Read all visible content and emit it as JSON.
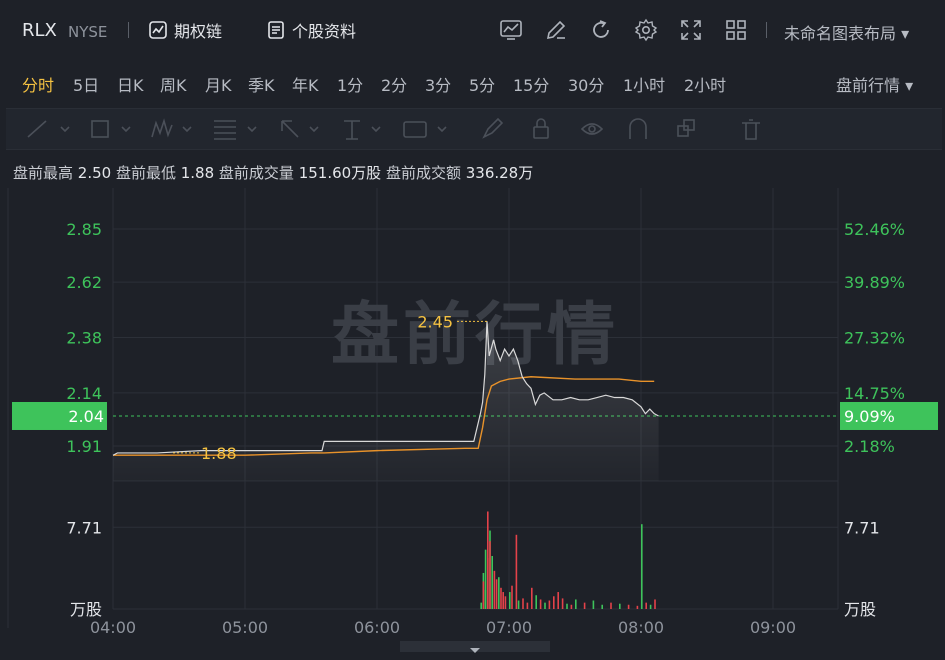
{
  "header": {
    "symbol": "RLX",
    "exchange": "NYSE",
    "option_chain_label": "期权链",
    "profile_label": "个股资料",
    "layout_label": "未命名图表布局"
  },
  "periods": [
    "分时",
    "5日",
    "日K",
    "周K",
    "月K",
    "季K",
    "年K",
    "1分",
    "2分",
    "3分",
    "5分",
    "15分",
    "30分",
    "1小时",
    "2小时"
  ],
  "active_period": "分时",
  "premarket_menu_label": "盘前行情",
  "stats": [
    {
      "label": "盘前最高",
      "value": "2.50"
    },
    {
      "label": "盘前最低",
      "value": "1.88"
    },
    {
      "label": "盘前成交量",
      "value": "151.60万股"
    },
    {
      "label": "盘前成交额",
      "value": "336.28万"
    }
  ],
  "colors": {
    "up": "#3ec35b",
    "down": "#e4424a",
    "price_line": "#d9d9d9",
    "avg_line": "#e8922a",
    "highlight": "#f5c242",
    "bg": "#1e2128"
  },
  "chart_data": {
    "type": "line",
    "watermark": "盘前行情",
    "x_ticks": [
      "04:00",
      "05:00",
      "06:00",
      "07:00",
      "08:00",
      "09:00"
    ],
    "x_range": [
      "04:00",
      "09:30"
    ],
    "y_ticks_left": [
      "2.85",
      "2.62",
      "2.38",
      "2.14",
      "1.91"
    ],
    "y_ticks_right": [
      "52.46%",
      "39.89%",
      "27.32%",
      "14.75%",
      "2.18%"
    ],
    "y_range": [
      1.7,
      2.95
    ],
    "prev_close": 2.04,
    "prev_close_label": "2.04",
    "prev_close_pct": "9.09%",
    "high_marker": {
      "time": "06:50",
      "value": 2.45,
      "label": "2.45"
    },
    "low_marker": {
      "time": "04:40",
      "value": 1.88,
      "label": "1.88"
    },
    "price": [
      [
        "04:00",
        1.87
      ],
      [
        "04:02",
        1.88
      ],
      [
        "04:10",
        1.88
      ],
      [
        "04:20",
        1.88
      ],
      [
        "04:40",
        1.89
      ],
      [
        "05:00",
        1.89
      ],
      [
        "05:20",
        1.89
      ],
      [
        "05:30",
        1.89
      ],
      [
        "05:35",
        1.89
      ],
      [
        "05:36",
        1.93
      ],
      [
        "05:50",
        1.93
      ],
      [
        "06:00",
        1.93
      ],
      [
        "06:20",
        1.93
      ],
      [
        "06:40",
        1.93
      ],
      [
        "06:44",
        1.93
      ],
      [
        "06:47",
        2.05
      ],
      [
        "06:48",
        2.1
      ],
      [
        "06:49",
        2.22
      ],
      [
        "06:50",
        2.45
      ],
      [
        "06:51",
        2.3
      ],
      [
        "06:53",
        2.37
      ],
      [
        "06:54",
        2.33
      ],
      [
        "06:56",
        2.28
      ],
      [
        "06:58",
        2.33
      ],
      [
        "07:00",
        2.3
      ],
      [
        "07:02",
        2.33
      ],
      [
        "07:04",
        2.28
      ],
      [
        "07:06",
        2.21
      ],
      [
        "07:08",
        2.18
      ],
      [
        "07:10",
        2.16
      ],
      [
        "07:12",
        2.09
      ],
      [
        "07:14",
        2.13
      ],
      [
        "07:16",
        2.14
      ],
      [
        "07:20",
        2.11
      ],
      [
        "07:24",
        2.11
      ],
      [
        "07:28",
        2.12
      ],
      [
        "07:32",
        2.11
      ],
      [
        "07:36",
        2.11
      ],
      [
        "07:40",
        2.12
      ],
      [
        "07:44",
        2.13
      ],
      [
        "07:48",
        2.12
      ],
      [
        "07:52",
        2.12
      ],
      [
        "07:56",
        2.11
      ],
      [
        "08:00",
        2.08
      ],
      [
        "08:02",
        2.05
      ],
      [
        "08:04",
        2.07
      ],
      [
        "08:06",
        2.05
      ],
      [
        "08:08",
        2.04
      ]
    ],
    "avg": [
      [
        "04:00",
        1.87
      ],
      [
        "04:30",
        1.87
      ],
      [
        "05:00",
        1.87
      ],
      [
        "05:30",
        1.88
      ],
      [
        "05:36",
        1.88
      ],
      [
        "06:00",
        1.89
      ],
      [
        "06:40",
        1.9
      ],
      [
        "06:46",
        1.9
      ],
      [
        "06:48",
        1.99
      ],
      [
        "06:50",
        2.11
      ],
      [
        "06:52",
        2.17
      ],
      [
        "06:56",
        2.19
      ],
      [
        "07:00",
        2.2
      ],
      [
        "07:10",
        2.21
      ],
      [
        "07:30",
        2.2
      ],
      [
        "07:50",
        2.2
      ],
      [
        "08:00",
        2.19
      ],
      [
        "08:06",
        2.19
      ]
    ],
    "volume_label": "7.71",
    "volume_unit": "万股",
    "volume_max": 10,
    "volume": [
      [
        "06:47",
        0.6,
        "up"
      ],
      [
        "06:47",
        3.4,
        "up"
      ],
      [
        "06:48",
        2.6,
        "down"
      ],
      [
        "06:48",
        1.8,
        "up"
      ],
      [
        "06:49",
        5.6,
        "up"
      ],
      [
        "06:49",
        4.8,
        "down"
      ],
      [
        "06:50",
        9.2,
        "down"
      ],
      [
        "06:50",
        7.4,
        "up"
      ],
      [
        "06:51",
        6.4,
        "down"
      ],
      [
        "06:52",
        5.0,
        "up"
      ],
      [
        "06:53",
        3.6,
        "down"
      ],
      [
        "06:54",
        2.8,
        "down"
      ],
      [
        "06:55",
        3.0,
        "up"
      ],
      [
        "06:56",
        2.0,
        "down"
      ],
      [
        "06:57",
        1.6,
        "down"
      ],
      [
        "06:58",
        1.2,
        "down"
      ],
      [
        "07:00",
        1.6,
        "up"
      ],
      [
        "07:01",
        2.2,
        "down"
      ],
      [
        "07:03",
        7.0,
        "down"
      ],
      [
        "07:04",
        0.8,
        "up"
      ],
      [
        "07:06",
        1.0,
        "down"
      ],
      [
        "07:08",
        0.6,
        "down"
      ],
      [
        "07:10",
        2.0,
        "down"
      ],
      [
        "07:12",
        1.3,
        "up"
      ],
      [
        "07:14",
        0.9,
        "down"
      ],
      [
        "07:16",
        0.6,
        "up"
      ],
      [
        "07:18",
        0.8,
        "down"
      ],
      [
        "07:20",
        1.2,
        "down"
      ],
      [
        "07:22",
        1.6,
        "down"
      ],
      [
        "07:24",
        1.0,
        "down"
      ],
      [
        "07:26",
        0.5,
        "up"
      ],
      [
        "07:28",
        0.4,
        "down"
      ],
      [
        "07:30",
        0.9,
        "up"
      ],
      [
        "07:34",
        0.6,
        "down"
      ],
      [
        "07:38",
        0.8,
        "up"
      ],
      [
        "07:42",
        0.4,
        "up"
      ],
      [
        "07:46",
        0.6,
        "down"
      ],
      [
        "07:50",
        0.5,
        "up"
      ],
      [
        "07:54",
        0.4,
        "down"
      ],
      [
        "07:58",
        0.3,
        "down"
      ],
      [
        "08:00",
        8.0,
        "up"
      ],
      [
        "08:02",
        0.6,
        "down"
      ],
      [
        "08:04",
        0.4,
        "up"
      ],
      [
        "08:06",
        0.9,
        "down"
      ]
    ]
  }
}
